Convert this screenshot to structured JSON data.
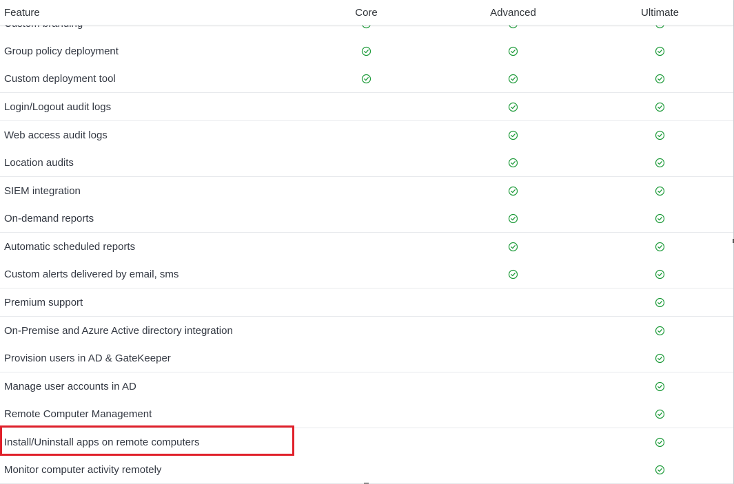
{
  "table": {
    "headers": {
      "feature": "Feature",
      "core": "Core",
      "advanced": "Advanced",
      "ultimate": "Ultimate"
    },
    "rows": [
      {
        "label": "Custom branding",
        "core": true,
        "advanced": true,
        "ultimate": true
      },
      {
        "label": "Group policy deployment",
        "core": true,
        "advanced": true,
        "ultimate": true
      },
      {
        "label": "Custom deployment tool",
        "core": true,
        "advanced": true,
        "ultimate": true
      },
      {
        "label": "Login/Logout audit logs",
        "core": false,
        "advanced": true,
        "ultimate": true
      },
      {
        "label": "Web access audit logs",
        "core": false,
        "advanced": true,
        "ultimate": true
      },
      {
        "label": "Location audits",
        "core": false,
        "advanced": true,
        "ultimate": true
      },
      {
        "label": "SIEM integration",
        "core": false,
        "advanced": true,
        "ultimate": true
      },
      {
        "label": "On-demand reports",
        "core": false,
        "advanced": true,
        "ultimate": true
      },
      {
        "label": "Automatic scheduled reports",
        "core": false,
        "advanced": true,
        "ultimate": true
      },
      {
        "label": "Custom alerts delivered by email, sms",
        "core": false,
        "advanced": true,
        "ultimate": true
      },
      {
        "label": "Premium support",
        "core": false,
        "advanced": false,
        "ultimate": true
      },
      {
        "label": "On-Premise and Azure Active directory integration",
        "core": false,
        "advanced": false,
        "ultimate": true
      },
      {
        "label": "Provision users in AD & GateKeeper",
        "core": false,
        "advanced": false,
        "ultimate": true
      },
      {
        "label": "Manage user accounts in AD",
        "core": false,
        "advanced": false,
        "ultimate": true
      },
      {
        "label": "Remote Computer Management",
        "core": false,
        "advanced": false,
        "ultimate": true
      },
      {
        "label": "Install/Uninstall apps on remote computers",
        "core": false,
        "advanced": false,
        "ultimate": true,
        "highlighted": true
      },
      {
        "label": "Monitor computer activity remotely",
        "core": false,
        "advanced": false,
        "ultimate": true
      }
    ]
  },
  "icons": {
    "included": "check-circle-icon"
  },
  "colors": {
    "check": "#1e9b3a",
    "highlight_border": "#e0202a",
    "grid_line": "#e7e9ec"
  }
}
